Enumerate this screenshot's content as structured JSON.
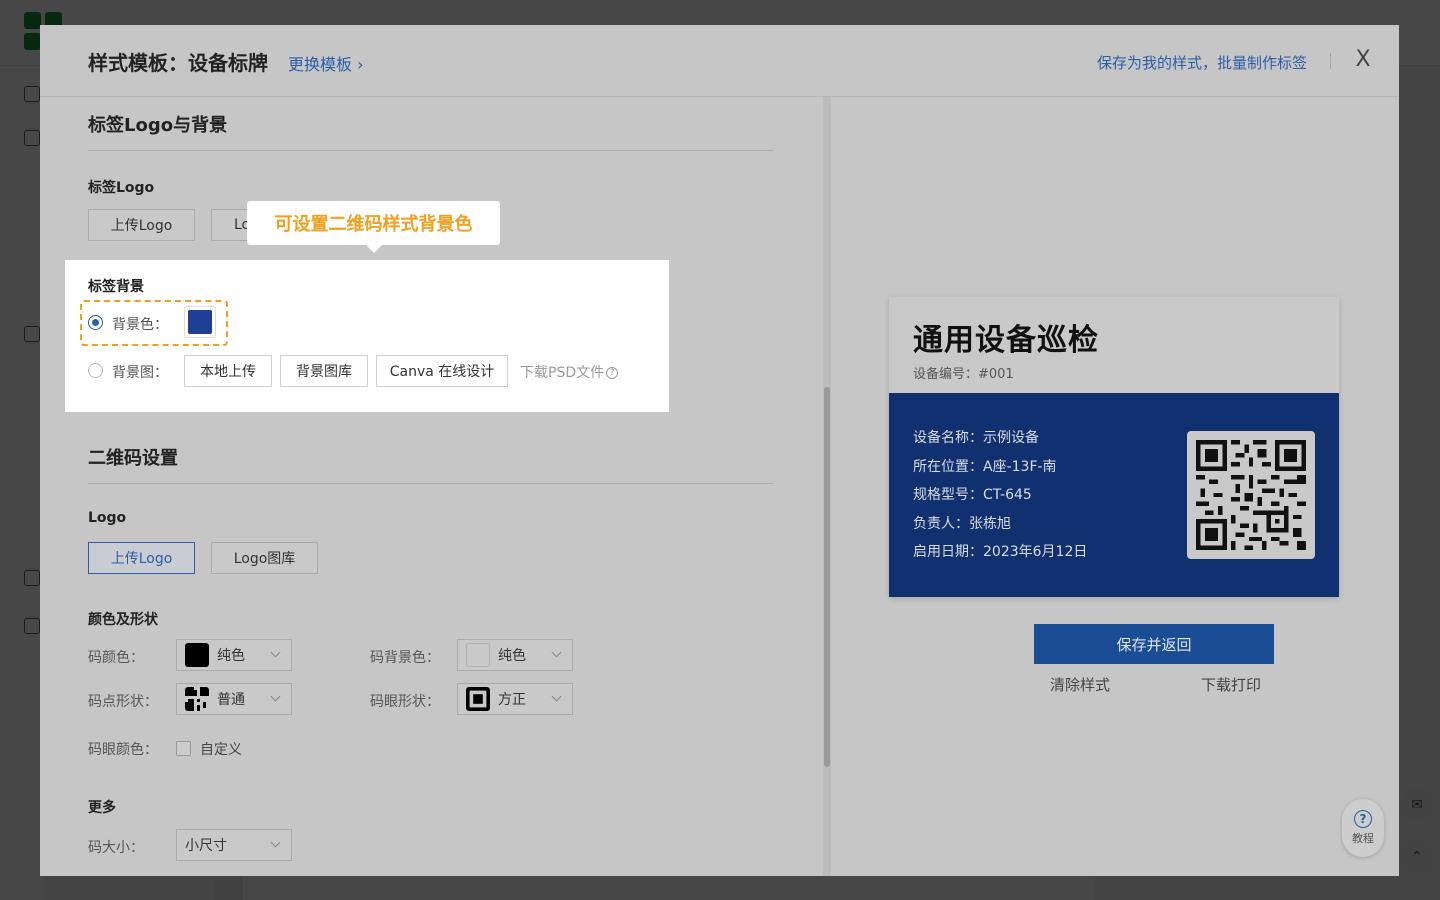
{
  "modal": {
    "title": "样式模板：设备标牌",
    "change_template": "更换模板 ›",
    "save_as_mine": "保存为我的样式，批量制作标签",
    "close": "X"
  },
  "label_section": {
    "title": "标签Logo与背景",
    "logo_subtitle": "标签Logo",
    "upload_logo": "上传Logo",
    "logo_library_partial": "Lo",
    "background_subtitle": "标签背景",
    "bg_color_label": "背景色：",
    "bg_color_value": "#1f3f96",
    "bg_image_label": "背景图：",
    "local_upload": "本地上传",
    "bg_library": "背景图库",
    "canva": "Canva 在线设计",
    "download_psd": "下载PSD文件",
    "tooltip": "可设置二维码样式背景色"
  },
  "qr_section": {
    "title": "二维码设置",
    "logo_subtitle": "Logo",
    "upload_logo": "上传Logo",
    "logo_library": "Logo图库",
    "color_shape_subtitle": "颜色及形状",
    "code_color_label": "码颜色：",
    "code_color_value": "纯色",
    "code_bg_label": "码背景色：",
    "code_bg_value": "纯色",
    "dot_shape_label": "码点形状：",
    "dot_shape_value": "普通",
    "eye_shape_label": "码眼形状：",
    "eye_shape_value": "方正",
    "eye_color_label": "码眼颜色：",
    "eye_color_custom": "自定义",
    "more_subtitle": "更多",
    "size_label": "码大小：",
    "size_value": "小尺寸"
  },
  "preview": {
    "title": "通用设备巡检",
    "code": "设备编号：#001",
    "fields": [
      "设备名称：示例设备",
      "所在位置：A座-13F-南",
      "规格型号：CT-645",
      "负责人：张栋旭",
      "启用日期：2023年6月12日"
    ],
    "label_bg_color": "#11306f",
    "save_return": "保存并返回",
    "clear_style": "清除样式",
    "download_print": "下载打印"
  },
  "help": {
    "label": "教程"
  }
}
